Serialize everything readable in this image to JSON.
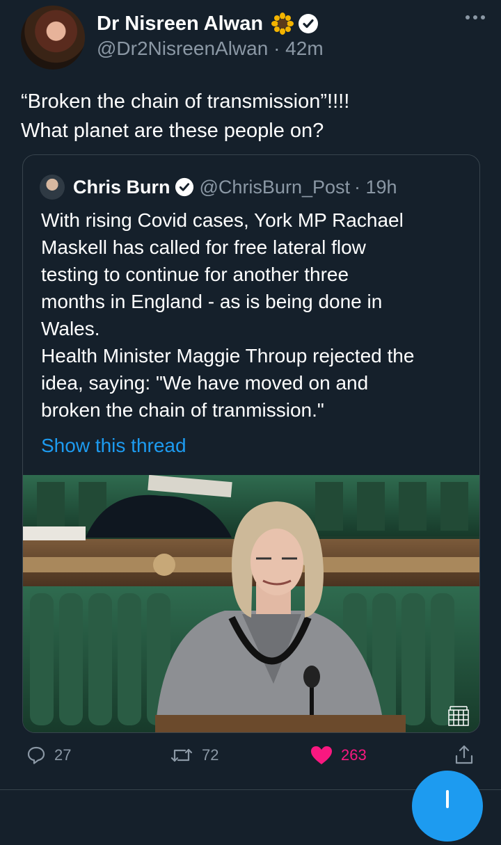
{
  "tweet": {
    "author_name": "Dr Nisreen Alwan",
    "handle": "@Dr2NisreenAlwan",
    "time": "· 42m",
    "text_line1": "“Broken the chain of transmission”!!!!",
    "text_line2": "What planet are these people on?"
  },
  "quote": {
    "author_name": "Chris Burn",
    "handle": "@ChrisBurn_Post",
    "time": "· 19h",
    "lines": [
      "With rising Covid cases, York MP Rachael",
      "Maskell has called for free lateral flow",
      "testing to continue for another three",
      "months in England - as is being done in",
      "Wales.",
      "Health Minister Maggie Throup rejected the",
      "idea, saying: \"We have moved on and",
      "broken the chain of tranmission.\""
    ],
    "show_thread": "Show this thread"
  },
  "actions": {
    "replies": "27",
    "retweets": "72",
    "likes": "263"
  },
  "colors": {
    "background": "#15202b",
    "accent": "#1d9bf0",
    "like": "#f91880",
    "muted": "#8b98a5"
  },
  "icons": [
    "sunflower-icon",
    "verified-icon",
    "more-icon",
    "reply-icon",
    "retweet-icon",
    "like-icon",
    "share-icon"
  ]
}
